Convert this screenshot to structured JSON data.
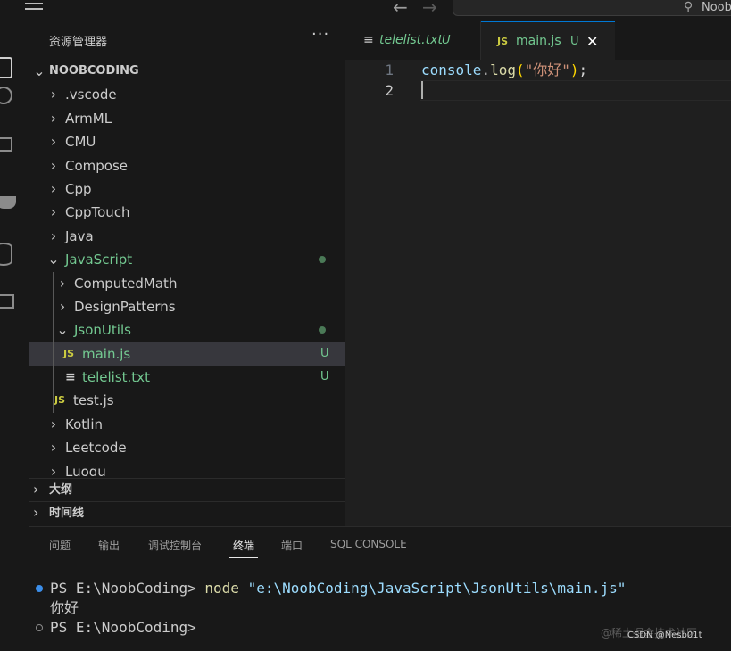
{
  "titlebar": {
    "search_text": "Noob"
  },
  "sidebar": {
    "title": "资源管理器",
    "more": "···",
    "root": "NOOBCODING",
    "items": [
      {
        "label": ".vscode"
      },
      {
        "label": "ArmML"
      },
      {
        "label": "CMU"
      },
      {
        "label": "Compose"
      },
      {
        "label": "Cpp"
      },
      {
        "label": "CppTouch"
      },
      {
        "label": "Java"
      },
      {
        "label": "JavaScript"
      },
      {
        "label": "ComputedMath"
      },
      {
        "label": "DesignPatterns"
      },
      {
        "label": "JsonUtils"
      },
      {
        "label": "main.js",
        "badge": "U",
        "icon": "JS"
      },
      {
        "label": "telelist.txt",
        "badge": "U",
        "icon": "≡"
      },
      {
        "label": "test.js",
        "icon": "JS"
      },
      {
        "label": "Kotlin"
      },
      {
        "label": "Leetcode"
      },
      {
        "label": "Luogu"
      }
    ],
    "outline_label": "大纲",
    "timeline_label": "时间线"
  },
  "editor": {
    "tabs": [
      {
        "label": "telelist.txt",
        "badge": "U",
        "icon": "≡"
      },
      {
        "label": "main.js",
        "badge": "U",
        "icon": "JS",
        "close": "✕"
      }
    ],
    "lines": [
      {
        "number": "1",
        "obj": "console",
        "dot": ".",
        "fn": "log",
        "open": "(",
        "str": "\"你好\"",
        "close": ")",
        "semi": ";"
      },
      {
        "number": "2"
      }
    ]
  },
  "panel": {
    "tabs": [
      "问题",
      "输出",
      "调试控制台",
      "终端",
      "端口",
      "SQL CONSOLE"
    ],
    "active_tab": "终端",
    "terminal": {
      "line1_prompt": "PS E:\\NoobCoding> ",
      "line1_cmd": "node",
      "line1_arg": "\"e:\\NoobCoding\\JavaScript\\JsonUtils\\main.js\"",
      "line2": "你好",
      "line3_prompt": "PS E:\\NoobCoding>"
    },
    "watermark": "@稀土掘金技术社区",
    "watermark2": "CSDN @Nesb01t"
  },
  "colors": {
    "modified": "#73c991",
    "accent": "#0078d4",
    "js_icon": "#cbcb41"
  }
}
